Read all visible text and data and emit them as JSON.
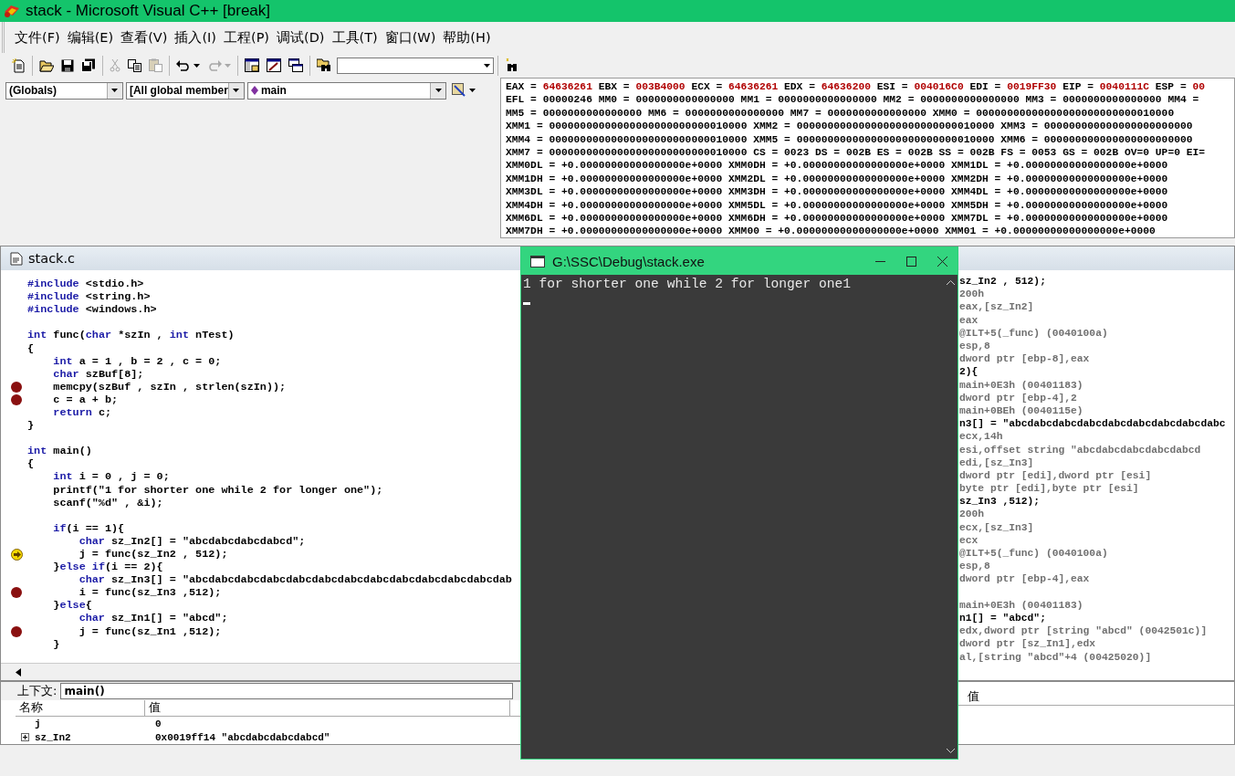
{
  "window": {
    "title": "stack - Microsoft Visual C++ [break]"
  },
  "menu": [
    "文件(F)",
    "编辑(E)",
    "查看(V)",
    "插入(I)",
    "工程(P)",
    "调试(D)",
    "工具(T)",
    "窗口(W)",
    "帮助(H)"
  ],
  "toolbar": [
    [
      {
        "kind": "new",
        "disabled": false
      }
    ],
    [
      {
        "kind": "open",
        "disabled": false
      },
      {
        "kind": "save",
        "disabled": false
      },
      {
        "kind": "save-all",
        "disabled": false
      }
    ],
    [
      {
        "kind": "cut",
        "disabled": true
      },
      {
        "kind": "copy",
        "disabled": false
      },
      {
        "kind": "paste",
        "disabled": true
      }
    ],
    [
      {
        "kind": "undo",
        "disabled": false
      },
      {
        "kind": "redo",
        "disabled": true
      }
    ],
    [
      {
        "kind": "workspace",
        "disabled": false
      },
      {
        "kind": "output",
        "disabled": false
      },
      {
        "kind": "windows",
        "disabled": false
      }
    ],
    [
      {
        "kind": "find-in-files",
        "disabled": false
      },
      {
        "kind": "combo",
        "disabled": false
      }
    ],
    [
      {
        "kind": "find",
        "disabled": false
      }
    ]
  ],
  "wizard_bar": {
    "scope": "(Globals)",
    "members": "[All global member",
    "function": "main"
  },
  "registers": [
    [
      {
        "label": "EAX = ",
        "value": "64636261",
        "changed": true
      },
      {
        "label": "EBX = ",
        "value": "003B4000",
        "changed": true
      },
      {
        "label": "ECX = ",
        "value": "64636261",
        "changed": true
      },
      {
        "label": "EDX = ",
        "value": "64636200",
        "changed": true
      },
      {
        "label": "ESI = ",
        "value": "004016C0",
        "changed": true
      },
      {
        "label": "EDI = ",
        "value": "0019FF30",
        "changed": true
      },
      {
        "label": "EIP = ",
        "value": "0040111C",
        "changed": true
      },
      {
        "label": "ESP = ",
        "value": "00",
        "changed": true
      }
    ],
    [
      {
        "label": "EFL = ",
        "value": "00000246",
        "changed": false
      },
      {
        "label": "MM0 = ",
        "value": "0000000000000000",
        "changed": false
      },
      {
        "label": "MM1 = ",
        "value": "0000000000000000",
        "changed": false
      },
      {
        "label": "MM2 = ",
        "value": "0000000000000000",
        "changed": false
      },
      {
        "label": "MM3 = ",
        "value": "0000000000000000",
        "changed": false
      },
      {
        "label": "MM4 =",
        "changed": false
      }
    ],
    [
      {
        "label": "MM5 = ",
        "value": "0000000000000000",
        "changed": false
      },
      {
        "label": "MM6 = ",
        "value": "0000000000000000",
        "changed": false
      },
      {
        "label": "MM7 = ",
        "value": "0000000000000000",
        "changed": false
      },
      {
        "label": "XMM0 = ",
        "value": "00000000000000000000000000010000",
        "changed": false
      }
    ],
    [
      {
        "label": "XMM1 = ",
        "value": "00000000000000000000000000010000",
        "changed": false
      },
      {
        "label": "XMM2 = ",
        "value": "00000000000000000000000000010000",
        "changed": false
      },
      {
        "label": "XMM3 = ",
        "value": "000000000000000000000000",
        "changed": false
      }
    ],
    [
      {
        "label": "XMM4 = ",
        "value": "00000000000000000000000000010000",
        "changed": false
      },
      {
        "label": "XMM5 = ",
        "value": "00000000000000000000000000010000",
        "changed": false
      },
      {
        "label": "XMM6 = ",
        "value": "000000000000000000000000",
        "changed": false
      }
    ],
    [
      {
        "label": "XMM7 = ",
        "value": "00000000000000000000000000010000",
        "changed": false
      },
      {
        "label": "CS = ",
        "value": "0023",
        "changed": false
      },
      {
        "label": "DS = ",
        "value": "002B",
        "changed": false
      },
      {
        "label": "ES = ",
        "value": "002B",
        "changed": false
      },
      {
        "label": "SS = ",
        "value": "002B",
        "changed": false
      },
      {
        "label": "FS = ",
        "value": "0053",
        "changed": false
      },
      {
        "label": "GS = ",
        "value": "002B",
        "changed": false
      },
      {
        "label": "OV=",
        "value": "0",
        "changed": false
      },
      {
        "label": "UP=",
        "value": "0",
        "changed": false
      },
      {
        "label": "EI=",
        "changed": false
      }
    ],
    [
      {
        "label": "XMM0DL = ",
        "value": "+0.00000000000000000e+0000",
        "changed": false
      },
      {
        "label": "XMM0DH = ",
        "value": "+0.00000000000000000e+0000",
        "changed": false
      },
      {
        "label": "XMM1DL = ",
        "value": "+0.00000000000000000e+0000",
        "changed": false
      }
    ],
    [
      {
        "label": "XMM1DH = ",
        "value": "+0.00000000000000000e+0000",
        "changed": false
      },
      {
        "label": "XMM2DL = ",
        "value": "+0.00000000000000000e+0000",
        "changed": false
      },
      {
        "label": "XMM2DH = ",
        "value": "+0.00000000000000000e+0000",
        "changed": false
      }
    ],
    [
      {
        "label": "XMM3DL = ",
        "value": "+0.00000000000000000e+0000",
        "changed": false
      },
      {
        "label": "XMM3DH = ",
        "value": "+0.00000000000000000e+0000",
        "changed": false
      },
      {
        "label": "XMM4DL = ",
        "value": "+0.00000000000000000e+0000",
        "changed": false
      }
    ],
    [
      {
        "label": "XMM4DH = ",
        "value": "+0.00000000000000000e+0000",
        "changed": false
      },
      {
        "label": "XMM5DL = ",
        "value": "+0.00000000000000000e+0000",
        "changed": false
      },
      {
        "label": "XMM5DH = ",
        "value": "+0.00000000000000000e+0000",
        "changed": false
      }
    ],
    [
      {
        "label": "XMM6DL = ",
        "value": "+0.00000000000000000e+0000",
        "changed": false
      },
      {
        "label": "XMM6DH = ",
        "value": "+0.00000000000000000e+0000",
        "changed": false
      },
      {
        "label": "XMM7DL = ",
        "value": "+0.00000000000000000e+0000",
        "changed": false
      }
    ],
    [
      {
        "label": "XMM7DH = ",
        "value": "+0.00000000000000000e+0000",
        "changed": false
      },
      {
        "label": "XMM00 = ",
        "value": "+0.00000000000000000e+0000",
        "changed": false
      },
      {
        "label": "XMM01 = ",
        "value": "+0.00000000000000000e+0000",
        "changed": false
      }
    ]
  ],
  "editor": {
    "title": "stack.c",
    "lines": [
      {
        "kind": "code",
        "breakpoint": false,
        "current": false,
        "tokens": [
          {
            "kind": "keyword",
            "text": "#include"
          },
          {
            "kind": "plain",
            "text": " <stdio.h>"
          }
        ]
      },
      {
        "kind": "code",
        "breakpoint": false,
        "current": false,
        "tokens": [
          {
            "kind": "keyword",
            "text": "#include"
          },
          {
            "kind": "plain",
            "text": " <string.h>"
          }
        ]
      },
      {
        "kind": "code",
        "breakpoint": false,
        "current": false,
        "tokens": [
          {
            "kind": "keyword",
            "text": "#include"
          },
          {
            "kind": "plain",
            "text": " <windows.h>"
          }
        ]
      },
      {
        "kind": "blank"
      },
      {
        "kind": "code",
        "breakpoint": false,
        "current": false,
        "tokens": [
          {
            "kind": "keyword",
            "text": "int"
          },
          {
            "kind": "plain",
            "text": " func("
          },
          {
            "kind": "keyword",
            "text": "char"
          },
          {
            "kind": "plain",
            "text": " *szIn , "
          },
          {
            "kind": "keyword",
            "text": "int"
          },
          {
            "kind": "plain",
            "text": " nTest)"
          }
        ]
      },
      {
        "kind": "code",
        "breakpoint": false,
        "current": false,
        "tokens": [
          {
            "kind": "plain",
            "text": "{"
          }
        ]
      },
      {
        "kind": "code",
        "breakpoint": false,
        "current": false,
        "tokens": [
          {
            "kind": "keyword",
            "text": "    int"
          },
          {
            "kind": "plain",
            "text": " a = 1 , b = 2 , c = 0;"
          }
        ]
      },
      {
        "kind": "code",
        "breakpoint": false,
        "current": false,
        "tokens": [
          {
            "kind": "keyword",
            "text": "    char"
          },
          {
            "kind": "plain",
            "text": " szBuf[8];"
          }
        ]
      },
      {
        "kind": "code",
        "breakpoint": true,
        "current": false,
        "tokens": [
          {
            "kind": "plain",
            "text": "    memcpy(szBuf , szIn , strlen(szIn));"
          }
        ]
      },
      {
        "kind": "code",
        "breakpoint": true,
        "current": false,
        "tokens": [
          {
            "kind": "plain",
            "text": "    c = a + b;"
          }
        ]
      },
      {
        "kind": "code",
        "breakpoint": false,
        "current": false,
        "tokens": [
          {
            "kind": "keyword",
            "text": "    return"
          },
          {
            "kind": "plain",
            "text": " c;"
          }
        ]
      },
      {
        "kind": "code",
        "breakpoint": false,
        "current": false,
        "tokens": [
          {
            "kind": "plain",
            "text": "}"
          }
        ]
      },
      {
        "kind": "blank"
      },
      {
        "kind": "code",
        "breakpoint": false,
        "current": false,
        "tokens": [
          {
            "kind": "keyword",
            "text": "int"
          },
          {
            "kind": "plain",
            "text": " main()"
          }
        ]
      },
      {
        "kind": "code",
        "breakpoint": false,
        "current": false,
        "tokens": [
          {
            "kind": "plain",
            "text": "{"
          }
        ]
      },
      {
        "kind": "code",
        "breakpoint": false,
        "current": false,
        "tokens": [
          {
            "kind": "keyword",
            "text": "    int"
          },
          {
            "kind": "plain",
            "text": " i = 0 , j = 0;"
          }
        ]
      },
      {
        "kind": "code",
        "breakpoint": false,
        "current": false,
        "tokens": [
          {
            "kind": "plain",
            "text": "    printf(\"1 for shorter one while 2 for longer one\");"
          }
        ]
      },
      {
        "kind": "code",
        "breakpoint": false,
        "current": false,
        "tokens": [
          {
            "kind": "plain",
            "text": "    scanf(\"%d\" , &i);"
          }
        ]
      },
      {
        "kind": "blank"
      },
      {
        "kind": "code",
        "breakpoint": false,
        "current": false,
        "tokens": [
          {
            "kind": "keyword",
            "text": "    if"
          },
          {
            "kind": "plain",
            "text": "(i == 1){"
          }
        ]
      },
      {
        "kind": "code",
        "breakpoint": false,
        "current": false,
        "tokens": [
          {
            "kind": "keyword",
            "text": "        char"
          },
          {
            "kind": "plain",
            "text": " sz_In2[] = \"abcdabcdabcdabcd\";"
          }
        ]
      },
      {
        "kind": "code",
        "breakpoint": false,
        "current": true,
        "tokens": [
          {
            "kind": "plain",
            "text": "        j = func(sz_In2 , 512);"
          }
        ]
      },
      {
        "kind": "code",
        "breakpoint": false,
        "current": false,
        "tokens": [
          {
            "kind": "plain",
            "text": "    }"
          },
          {
            "kind": "keyword",
            "text": "else if"
          },
          {
            "kind": "plain",
            "text": "(i == 2){"
          }
        ]
      },
      {
        "kind": "code",
        "breakpoint": false,
        "current": false,
        "tokens": [
          {
            "kind": "keyword",
            "text": "        char"
          },
          {
            "kind": "plain",
            "text": " sz_In3[] = \"abcdabcdabcdabcdabcdabcdabcdabcdabcdabcdabcdabcdab"
          }
        ]
      },
      {
        "kind": "code",
        "breakpoint": true,
        "current": false,
        "tokens": [
          {
            "kind": "plain",
            "text": "        i = func(sz_In3 ,512);"
          }
        ]
      },
      {
        "kind": "code",
        "breakpoint": false,
        "current": false,
        "tokens": [
          {
            "kind": "plain",
            "text": "    }"
          },
          {
            "kind": "keyword",
            "text": "else"
          },
          {
            "kind": "plain",
            "text": "{"
          }
        ]
      },
      {
        "kind": "code",
        "breakpoint": false,
        "current": false,
        "tokens": [
          {
            "kind": "keyword",
            "text": "        char"
          },
          {
            "kind": "plain",
            "text": " sz_In1[] = \"abcd\";"
          }
        ]
      },
      {
        "kind": "code",
        "breakpoint": true,
        "current": false,
        "tokens": [
          {
            "kind": "plain",
            "text": "        j = func(sz_In1 ,512);"
          }
        ]
      },
      {
        "kind": "code",
        "breakpoint": false,
        "current": false,
        "tokens": [
          {
            "kind": "plain",
            "text": "    }"
          }
        ]
      }
    ]
  },
  "disassembly": {
    "lines": [
      {
        "kind": "source",
        "text": "sz_In2 , 512);"
      },
      {
        "kind": "asm",
        "text": "200h"
      },
      {
        "kind": "asm",
        "text": "eax,[sz_In2]"
      },
      {
        "kind": "asm",
        "text": "eax"
      },
      {
        "kind": "asm",
        "text": "@ILT+5(_func) (0040100a)"
      },
      {
        "kind": "asm",
        "text": "esp,8"
      },
      {
        "kind": "asm",
        "text": "dword ptr [ebp-8],eax"
      },
      {
        "kind": "source",
        "text": "2){"
      },
      {
        "kind": "asm",
        "text": "main+0E3h (00401183)"
      },
      {
        "kind": "asm",
        "text": "dword ptr [ebp-4],2"
      },
      {
        "kind": "asm",
        "text": "main+0BEh (0040115e)"
      },
      {
        "kind": "source",
        "text": "n3[] = \"abcdabcdabcdabcdabcdabcdabcdabcdabc"
      },
      {
        "kind": "asm",
        "text": "ecx,14h"
      },
      {
        "kind": "asm",
        "text": "esi,offset string \"abcdabcdabcdabcdabcd"
      },
      {
        "kind": "asm",
        "text": "edi,[sz_In3]"
      },
      {
        "kind": "asm",
        "text": "dword ptr [edi],dword ptr [esi]"
      },
      {
        "kind": "asm",
        "text": "byte ptr [edi],byte ptr [esi]"
      },
      {
        "kind": "source",
        "text": "sz_In3 ,512);"
      },
      {
        "kind": "asm",
        "text": "200h"
      },
      {
        "kind": "asm",
        "text": "ecx,[sz_In3]"
      },
      {
        "kind": "asm",
        "text": "ecx"
      },
      {
        "kind": "asm",
        "text": "@ILT+5(_func) (0040100a)"
      },
      {
        "kind": "asm",
        "text": "esp,8"
      },
      {
        "kind": "asm",
        "text": "dword ptr [ebp-4],eax"
      },
      {
        "kind": "blank"
      },
      {
        "kind": "asm",
        "text": "main+0E3h (00401183)"
      },
      {
        "kind": "source",
        "text": "n1[] = \"abcd\";"
      },
      {
        "kind": "asm",
        "text": "edx,dword ptr [string \"abcd\" (0042501c)]"
      },
      {
        "kind": "asm",
        "text": "dword ptr [sz_In1],edx"
      },
      {
        "kind": "asm",
        "text": "al,[string \"abcd\"+4 (00425020)]"
      }
    ]
  },
  "console": {
    "title": "G:\\SSC\\Debug\\stack.exe",
    "output": "1 for shorter one while 2 for longer one1"
  },
  "variables": {
    "context_label": "上下文:",
    "context": "main()",
    "columns": [
      "名称",
      "值"
    ],
    "rows": [
      {
        "name": "j",
        "value": "0",
        "expandable": false
      },
      {
        "name": "sz_In2",
        "value": "0x0019ff14 \"abcdabcdabcdabcd\"",
        "expandable": true
      }
    ]
  },
  "watch": {
    "columns": [
      "值"
    ]
  }
}
